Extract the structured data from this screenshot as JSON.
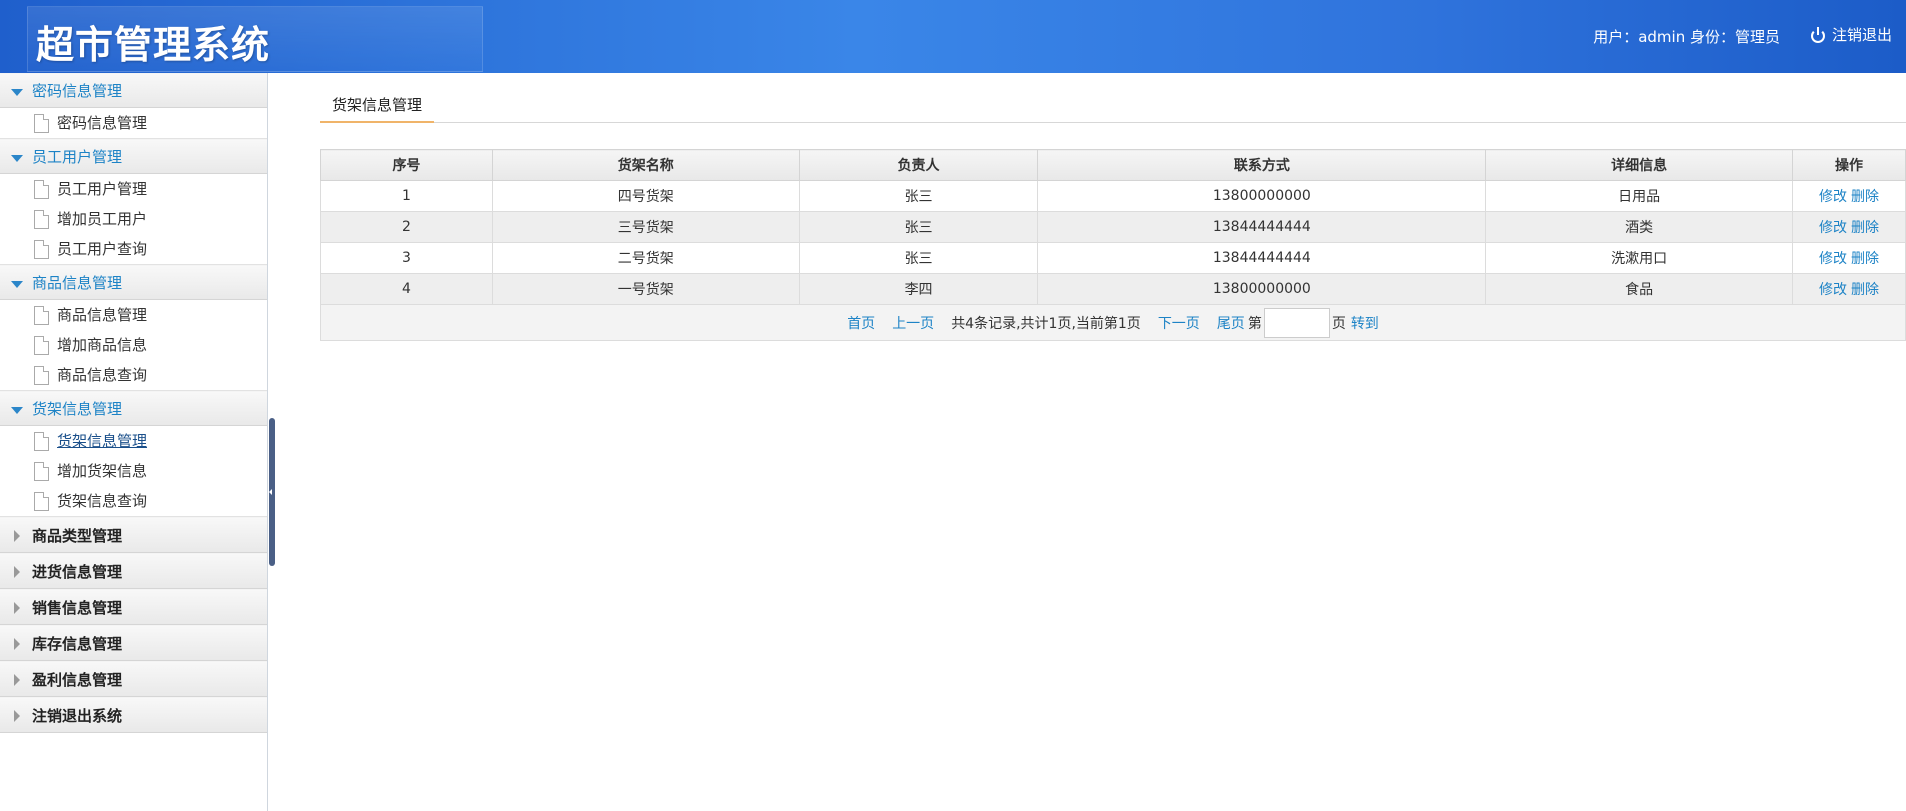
{
  "header": {
    "title": "超市管理系统",
    "user_info": "用户：admin 身份：管理员",
    "logout_label": "注销退出"
  },
  "sidebar": {
    "groups": [
      {
        "label": "密码信息管理",
        "open": true,
        "items": [
          "密码信息管理"
        ]
      },
      {
        "label": "员工用户管理",
        "open": true,
        "items": [
          "员工用户管理",
          "增加员工用户",
          "员工用户查询"
        ]
      },
      {
        "label": "商品信息管理",
        "open": true,
        "items": [
          "商品信息管理",
          "增加商品信息",
          "商品信息查询"
        ]
      },
      {
        "label": "货架信息管理",
        "open": true,
        "items": [
          "货架信息管理",
          "增加货架信息",
          "货架信息查询"
        ]
      },
      {
        "label": "商品类型管理",
        "open": false,
        "items": []
      },
      {
        "label": "进货信息管理",
        "open": false,
        "items": []
      },
      {
        "label": "销售信息管理",
        "open": false,
        "items": []
      },
      {
        "label": "库存信息管理",
        "open": false,
        "items": []
      },
      {
        "label": "盈利信息管理",
        "open": false,
        "items": []
      },
      {
        "label": "注销退出系统",
        "open": false,
        "items": []
      }
    ]
  },
  "main": {
    "tab_label": "货架信息管理",
    "table": {
      "columns": [
        "序号",
        "货架名称",
        "负责人",
        "联系方式",
        "详细信息",
        "操作"
      ],
      "rows": [
        {
          "no": "1",
          "name": "四号货架",
          "owner": "张三",
          "phone": "13800000000",
          "detail": "日用品"
        },
        {
          "no": "2",
          "name": "三号货架",
          "owner": "张三",
          "phone": "13844444444",
          "detail": "酒类"
        },
        {
          "no": "3",
          "name": "二号货架",
          "owner": "张三",
          "phone": "13844444444",
          "detail": "洗漱用口"
        },
        {
          "no": "4",
          "name": "一号货架",
          "owner": "李四",
          "phone": "13800000000",
          "detail": "食品"
        }
      ],
      "edit_label": "修改",
      "delete_label": "删除"
    },
    "pager": {
      "first": "首页",
      "prev": "上一页",
      "summary": "共4条记录,共计1页,当前第1页",
      "next": "下一页",
      "last": "尾页",
      "page_prefix": "第",
      "page_input_value": "",
      "page_suffix": "页",
      "goto": "转到"
    }
  },
  "colors": {
    "header_blue": "#2f73dc",
    "link_blue": "#1d83c6",
    "tab_underline": "#f0b469"
  }
}
